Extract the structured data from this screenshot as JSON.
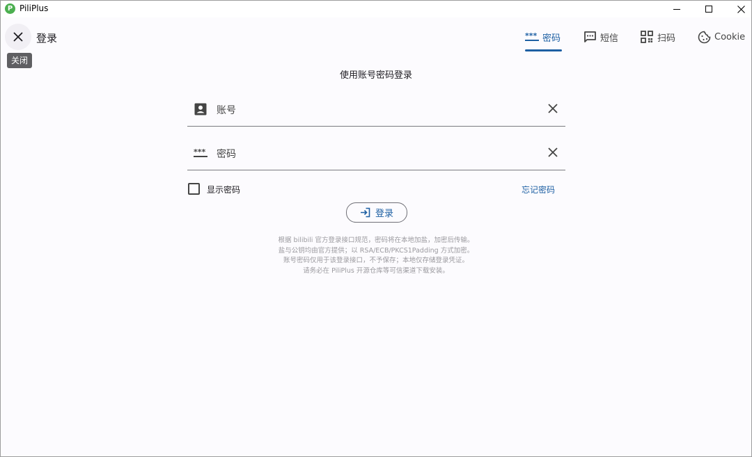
{
  "titlebar": {
    "app_name": "PiliPlus",
    "logo_letter": "P",
    "logo_color": "#4caf50"
  },
  "header": {
    "title": "登录",
    "close_tooltip": "关闭",
    "tabs": [
      {
        "label": "密码",
        "icon": "password-icon",
        "active": true
      },
      {
        "label": "短信",
        "icon": "sms-icon",
        "active": false
      },
      {
        "label": "扫码",
        "icon": "qrcode-icon",
        "active": false
      },
      {
        "label": "Cookie",
        "icon": "cookie-icon",
        "active": false
      }
    ],
    "accent_color": "#1d5fa3"
  },
  "form": {
    "heading": "使用账号密码登录",
    "account_label": "账号",
    "password_label": "密码",
    "show_password_label": "显示密码",
    "show_password_checked": false,
    "forgot_label": "忘记密码",
    "login_label": "登录"
  },
  "notice": {
    "lines": [
      "根据 bilibili 官方登录接口规范，密码将在本地加盐，加密后传输。",
      "盐与公钥均由官方提供；以 RSA/ECB/PKCS1Padding 方式加密。",
      "账号密码仅用于该登录接口，不予保存；本地仅存储登录凭证。",
      "请务必在 PiliPlus 开源仓库等可信渠道下载安装。"
    ]
  }
}
